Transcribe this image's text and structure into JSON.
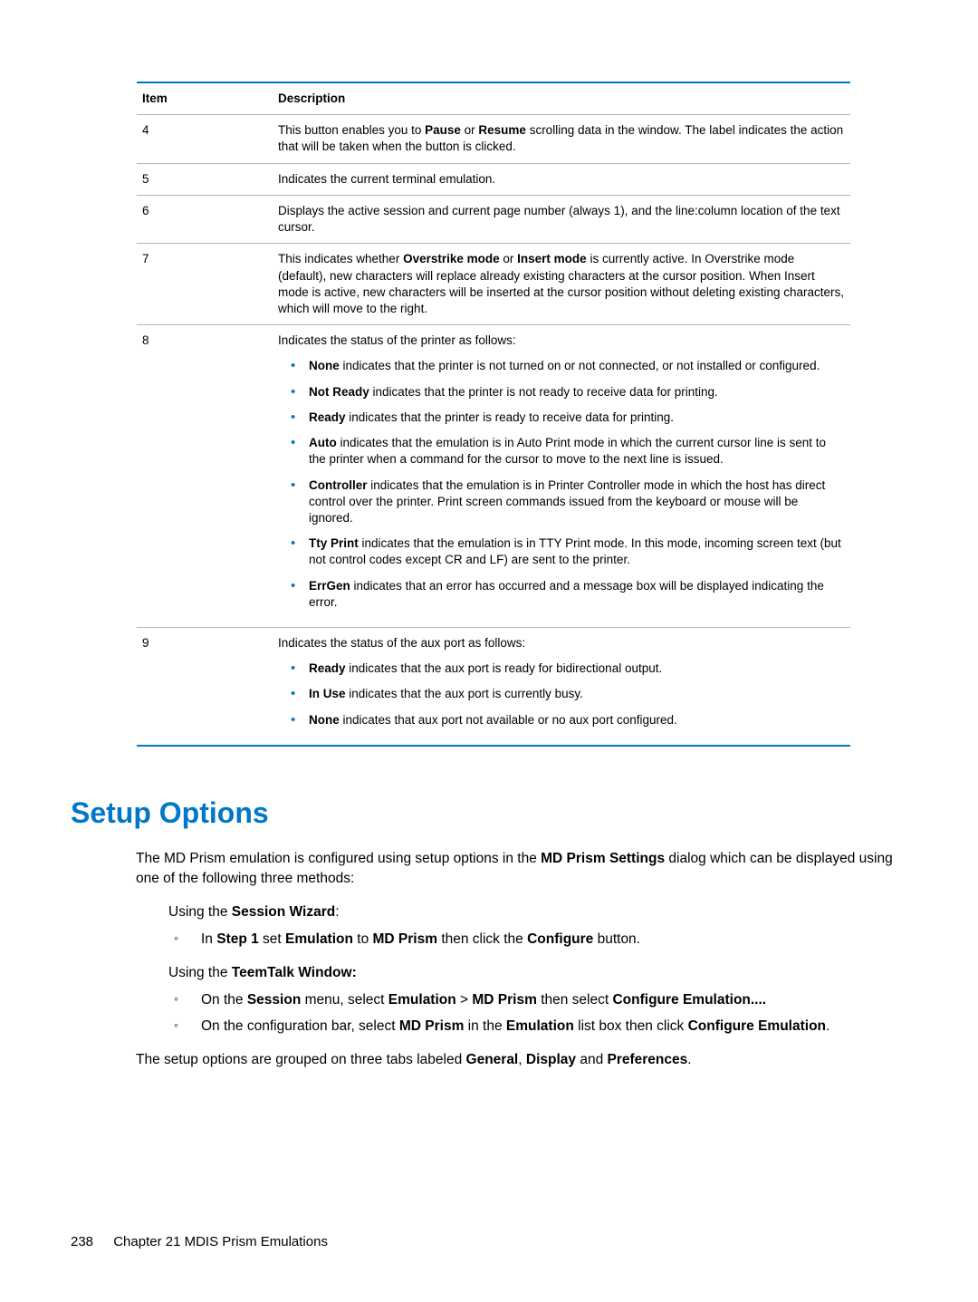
{
  "table": {
    "headers": {
      "item": "Item",
      "desc": "Description"
    },
    "rows": [
      {
        "item": "4",
        "desc_pre": "This button enables you to ",
        "b1": "Pause",
        "mid1": " or ",
        "b2": "Resume",
        "desc_post": " scrolling data in the window. The label indicates the action that will be taken when the button is clicked."
      },
      {
        "item": "5",
        "desc": "Indicates the current terminal emulation."
      },
      {
        "item": "6",
        "desc": "Displays the active session and current page number (always 1), and the line:column location of the text cursor."
      },
      {
        "item": "7",
        "pre": "This indicates whether ",
        "b1": "Overstrike mode",
        "mid1": " or ",
        "b2": "Insert mode",
        "post": " is currently active. In Overstrike mode (default), new characters will replace already existing characters at the cursor position. When Insert mode is active, new characters will be inserted at the cursor position without deleting existing characters, which will move to the right."
      },
      {
        "item": "8",
        "lead": "Indicates the status of the printer as follows:",
        "bullets": [
          {
            "b": "None",
            "t": " indicates that the printer is not turned on or not connected, or not installed or configured."
          },
          {
            "b": "Not Ready",
            "t": " indicates that the printer is not ready to receive data for printing."
          },
          {
            "b": "Ready",
            "t": " indicates that the printer is ready to receive data for printing."
          },
          {
            "b": "Auto",
            "t": " indicates that the emulation is in Auto Print mode in which the current cursor line is sent to the printer when a command for the cursor to move to the next line is issued."
          },
          {
            "b": "Controller",
            "t": " indicates that the emulation is in Printer Controller mode in which the host has direct control over the printer. Print screen commands issued from the keyboard or mouse will be ignored."
          },
          {
            "b": "Tty Print",
            "t": " indicates that the emulation is in TTY Print mode. In this mode, incoming screen text (but not control codes except CR and LF) are sent to the printer."
          },
          {
            "b": "ErrGen",
            "t": " indicates that an error has occurred and a message box will be displayed indicating the error."
          }
        ]
      },
      {
        "item": "9",
        "lead": "Indicates the status of the aux port as follows:",
        "bullets": [
          {
            "b": "Ready",
            "t": " indicates that the aux port is ready for bidirectional output."
          },
          {
            "b": "In Use",
            "t": " indicates that the aux port is currently busy."
          },
          {
            "b": "None",
            "t": " indicates that aux port not available or no aux port configured."
          }
        ]
      }
    ]
  },
  "heading": "Setup Options",
  "para1": {
    "pre": "The MD Prism emulation is configured using setup options in the ",
    "b": "MD Prism Settings",
    "post": " dialog which can be displayed using one of the following three methods:"
  },
  "using1": {
    "pre": "Using the ",
    "b": "Session Wizard",
    "post": ":"
  },
  "step1": {
    "pre": "In ",
    "b1": "Step 1",
    "m1": " set ",
    "b2": "Emulation",
    "m2": " to ",
    "b3": "MD Prism",
    "m3": " then click the ",
    "b4": "Configure",
    "post": " button."
  },
  "using2": {
    "pre": "Using the ",
    "b": "TeemTalk Window:"
  },
  "tt1": {
    "pre": "On the ",
    "b1": "Session",
    "m1": " menu, select ",
    "b2": "Emulation",
    "gt": " > ",
    "b3": "MD Prism",
    "m2": " then select ",
    "b4": "Configure Emulation....",
    "post": ""
  },
  "tt2": {
    "pre": "On the configuration bar, select ",
    "b1": "MD Prism",
    "m1": " in the ",
    "b2": "Emulation",
    "m2": " list box then click ",
    "b3": "Configure Emulation",
    "post": "."
  },
  "para2": {
    "pre": "The setup options are grouped on three tabs labeled ",
    "b1": "General",
    "c1": ", ",
    "b2": "Display",
    "c2": " and ",
    "b3": "Preferences",
    "post": "."
  },
  "footer": {
    "page": "238",
    "chapter": "Chapter 21   MDIS Prism Emulations"
  }
}
